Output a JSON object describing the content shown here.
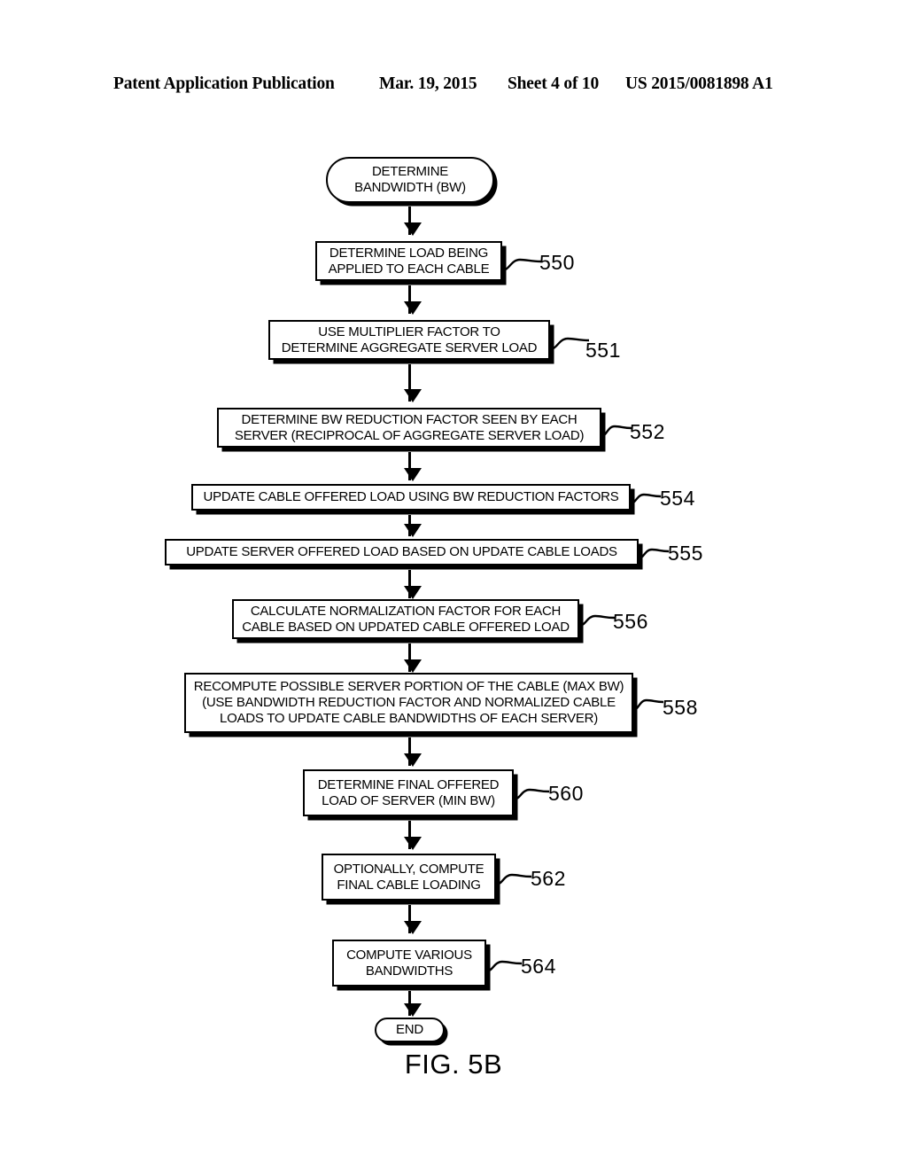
{
  "header": {
    "publication": "Patent Application Publication",
    "date": "Mar. 19, 2015",
    "sheet": "Sheet 4 of 10",
    "patent_number": "US 2015/0081898 A1"
  },
  "figure": {
    "caption": "FIG. 5B",
    "nodes": [
      {
        "id": "start",
        "shape": "terminator",
        "text": "DETERMINE\nBANDWIDTH (BW)",
        "ref": null
      },
      {
        "id": "n550",
        "shape": "process",
        "text": "DETERMINE LOAD BEING\nAPPLIED TO EACH CABLE",
        "ref": "550"
      },
      {
        "id": "n551",
        "shape": "process",
        "text": "USE MULTIPLIER FACTOR TO\nDETERMINE AGGREGATE SERVER LOAD",
        "ref": "551"
      },
      {
        "id": "n552",
        "shape": "process",
        "text": "DETERMINE BW REDUCTION FACTOR SEEN BY EACH\nSERVER (RECIPROCAL OF AGGREGATE SERVER LOAD)",
        "ref": "552"
      },
      {
        "id": "n554",
        "shape": "process",
        "text": "UPDATE CABLE OFFERED LOAD USING BW REDUCTION FACTORS",
        "ref": "554"
      },
      {
        "id": "n555",
        "shape": "process",
        "text": "UPDATE SERVER OFFERED LOAD BASED ON UPDATE CABLE LOADS",
        "ref": "555"
      },
      {
        "id": "n556",
        "shape": "process",
        "text": "CALCULATE NORMALIZATION FACTOR FOR EACH\nCABLE BASED ON UPDATED CABLE OFFERED LOAD",
        "ref": "556"
      },
      {
        "id": "n558",
        "shape": "process",
        "text": "RECOMPUTE POSSIBLE SERVER PORTION OF THE CABLE (MAX BW)\n(USE BANDWIDTH REDUCTION FACTOR AND NORMALIZED CABLE\nLOADS TO UPDATE CABLE BANDWIDTHS OF EACH SERVER)",
        "ref": "558"
      },
      {
        "id": "n560",
        "shape": "process",
        "text": "DETERMINE FINAL OFFERED\nLOAD OF SERVER (MIN BW)",
        "ref": "560"
      },
      {
        "id": "n562",
        "shape": "process",
        "text": "OPTIONALLY, COMPUTE\nFINAL CABLE LOADING",
        "ref": "562"
      },
      {
        "id": "n564",
        "shape": "process",
        "text": "COMPUTE VARIOUS\nBANDWIDTHS",
        "ref": "564"
      },
      {
        "id": "end",
        "shape": "terminator",
        "text": "END",
        "ref": null
      }
    ]
  }
}
